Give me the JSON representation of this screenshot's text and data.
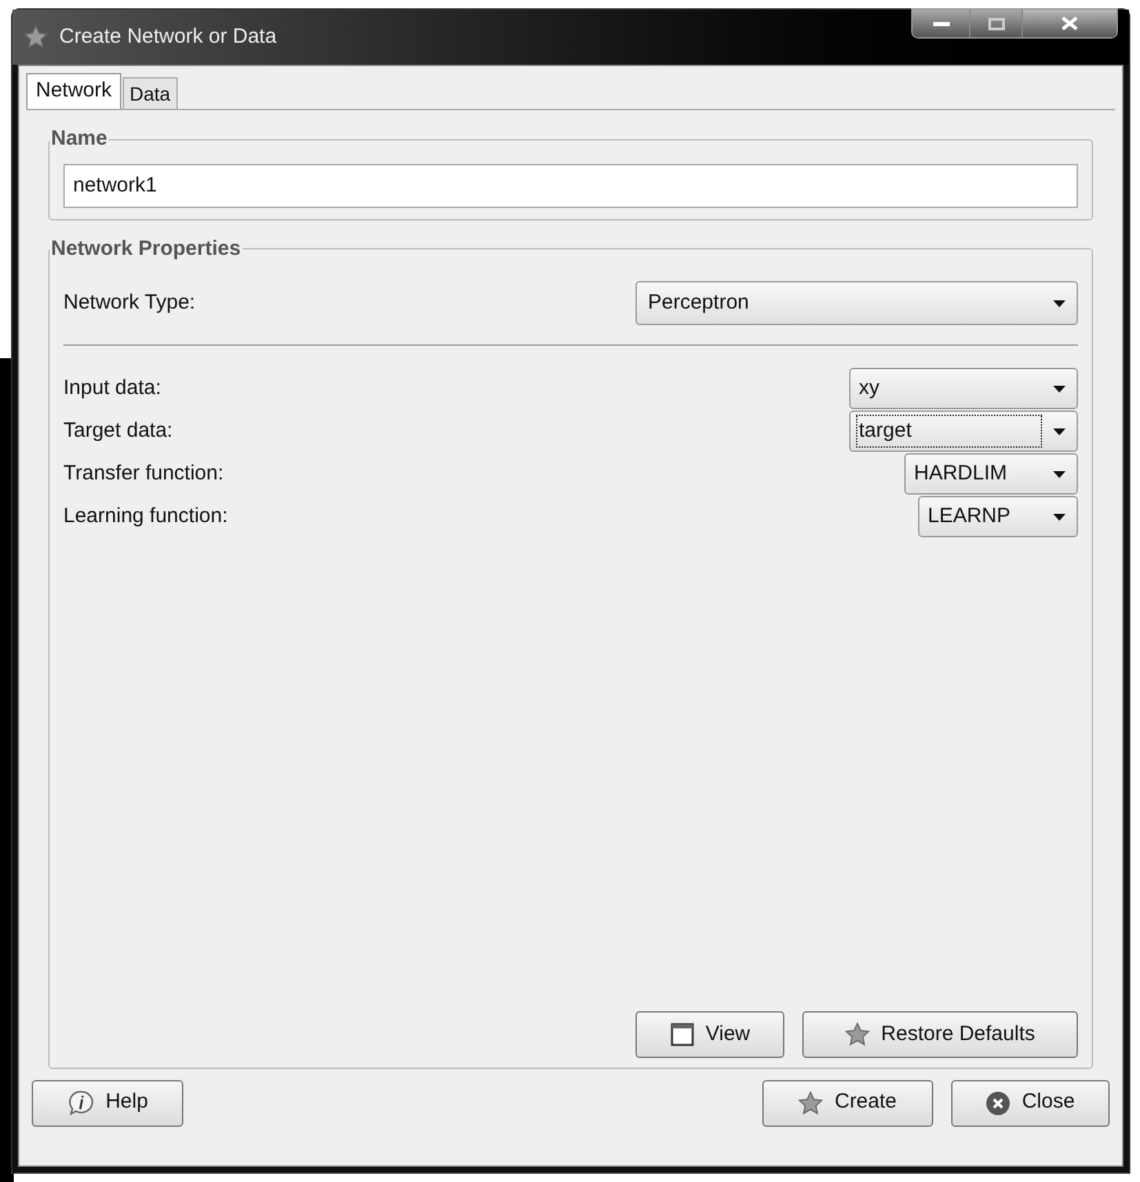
{
  "window": {
    "title": "Create Network or Data"
  },
  "tabs": [
    {
      "label": "Network",
      "selected": true
    },
    {
      "label": "Data",
      "selected": false
    }
  ],
  "name_group": {
    "title": "Name",
    "value": "network1"
  },
  "properties": {
    "title": "Network Properties",
    "network_type": {
      "label": "Network Type:",
      "value": "Perceptron"
    },
    "fields": [
      {
        "label": "Input data:",
        "value": "xy",
        "focused": false
      },
      {
        "label": "Target data:",
        "value": "target",
        "focused": true
      },
      {
        "label": "Transfer function:",
        "value": "HARDLIM",
        "focused": false
      },
      {
        "label": "Learning function:",
        "value": "LEARNP",
        "focused": false
      }
    ],
    "buttons": [
      {
        "kind": "view",
        "label": "View"
      },
      {
        "kind": "restore",
        "label": "Restore Defaults"
      }
    ]
  },
  "footer": [
    {
      "kind": "help",
      "label": "Help"
    },
    {
      "kind": "create",
      "label": "Create"
    },
    {
      "kind": "close",
      "label": "Close"
    }
  ]
}
